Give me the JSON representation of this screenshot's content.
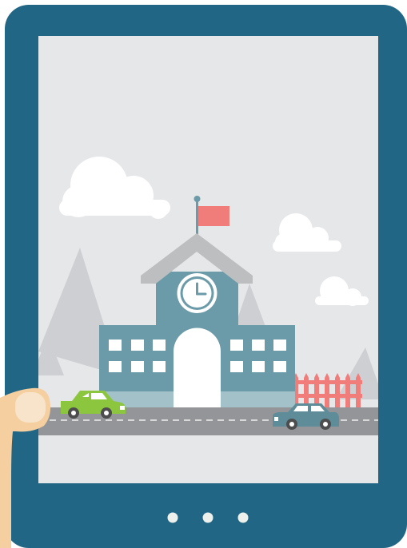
{
  "device": {
    "frame_color": "#226685",
    "screen_color": "#e6e7e9",
    "dot_color": "#eef0ec",
    "page_count": 3,
    "icon": "tablet-icon"
  },
  "scene": {
    "sky_color": "#e6e7e9",
    "mountain_color": "#cdcfd2",
    "cloud_color": "#ffffff",
    "building_color": "#6b9aa8",
    "building_base_color": "#a2c1c9",
    "roof_color": "#bcbec0",
    "window_color": "#ffffff",
    "clock_face_color": "#ffffff",
    "flag_color": "#f07d7a",
    "fence_color": "#f07d7a",
    "road_color": "#939598",
    "road_marking_color": "#d9d9d9",
    "green_car_color": "#8cc63f",
    "blue_car_color": "#5f8c99",
    "wheel_color": "#4d4d4d",
    "icons": [
      "school-building-icon",
      "clock-icon",
      "flag-icon",
      "cloud-icon",
      "mountain-icon",
      "car-icon",
      "fence-icon"
    ]
  },
  "hand": {
    "skin_color": "#f5cfa0",
    "nail_color": "#f7e4cb"
  }
}
